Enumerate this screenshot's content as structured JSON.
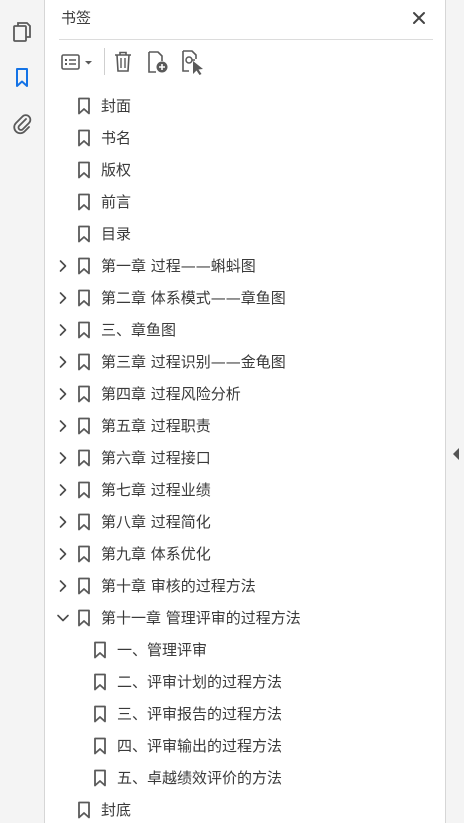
{
  "panel": {
    "title": "书签"
  },
  "icons": {
    "rail": [
      "pages-icon",
      "bookmark-icon",
      "attachment-icon"
    ],
    "toolbar": [
      "options-menu-icon",
      "delete-bookmark-icon",
      "new-bookmark-icon",
      "new-bookmark-from-structure-icon"
    ]
  },
  "colors": {
    "accent": "#1473e6",
    "icon": "#5a5a5a"
  },
  "bookmarks": [
    {
      "label": "封面",
      "level": 0,
      "expander": "none"
    },
    {
      "label": "书名",
      "level": 0,
      "expander": "none"
    },
    {
      "label": "版权",
      "level": 0,
      "expander": "none"
    },
    {
      "label": "前言",
      "level": 0,
      "expander": "none"
    },
    {
      "label": "目录",
      "level": 0,
      "expander": "none"
    },
    {
      "label": "第一章  过程——蝌蚪图",
      "level": 0,
      "expander": "collapsed"
    },
    {
      "label": "第二章  体系模式——章鱼图",
      "level": 0,
      "expander": "collapsed"
    },
    {
      "label": "三、章鱼图",
      "level": 0,
      "expander": "collapsed"
    },
    {
      "label": "第三章  过程识别——金龟图",
      "level": 0,
      "expander": "collapsed"
    },
    {
      "label": "第四章  过程风险分析",
      "level": 0,
      "expander": "collapsed"
    },
    {
      "label": "第五章  过程职责",
      "level": 0,
      "expander": "collapsed"
    },
    {
      "label": "第六章  过程接口",
      "level": 0,
      "expander": "collapsed"
    },
    {
      "label": "第七章  过程业绩",
      "level": 0,
      "expander": "collapsed"
    },
    {
      "label": "第八章  过程简化",
      "level": 0,
      "expander": "collapsed"
    },
    {
      "label": "第九章  体系优化",
      "level": 0,
      "expander": "collapsed"
    },
    {
      "label": "第十章  审核的过程方法",
      "level": 0,
      "expander": "collapsed"
    },
    {
      "label": "第十一章  管理评审的过程方法",
      "level": 0,
      "expander": "expanded"
    },
    {
      "label": "一、管理评审",
      "level": 1,
      "expander": "none"
    },
    {
      "label": "二、评审计划的过程方法",
      "level": 1,
      "expander": "none"
    },
    {
      "label": "三、评审报告的过程方法",
      "level": 1,
      "expander": "none"
    },
    {
      "label": "四、评审输出的过程方法",
      "level": 1,
      "expander": "none"
    },
    {
      "label": "五、卓越绩效评价的方法",
      "level": 1,
      "expander": "none"
    },
    {
      "label": "封底",
      "level": 0,
      "expander": "none"
    }
  ]
}
